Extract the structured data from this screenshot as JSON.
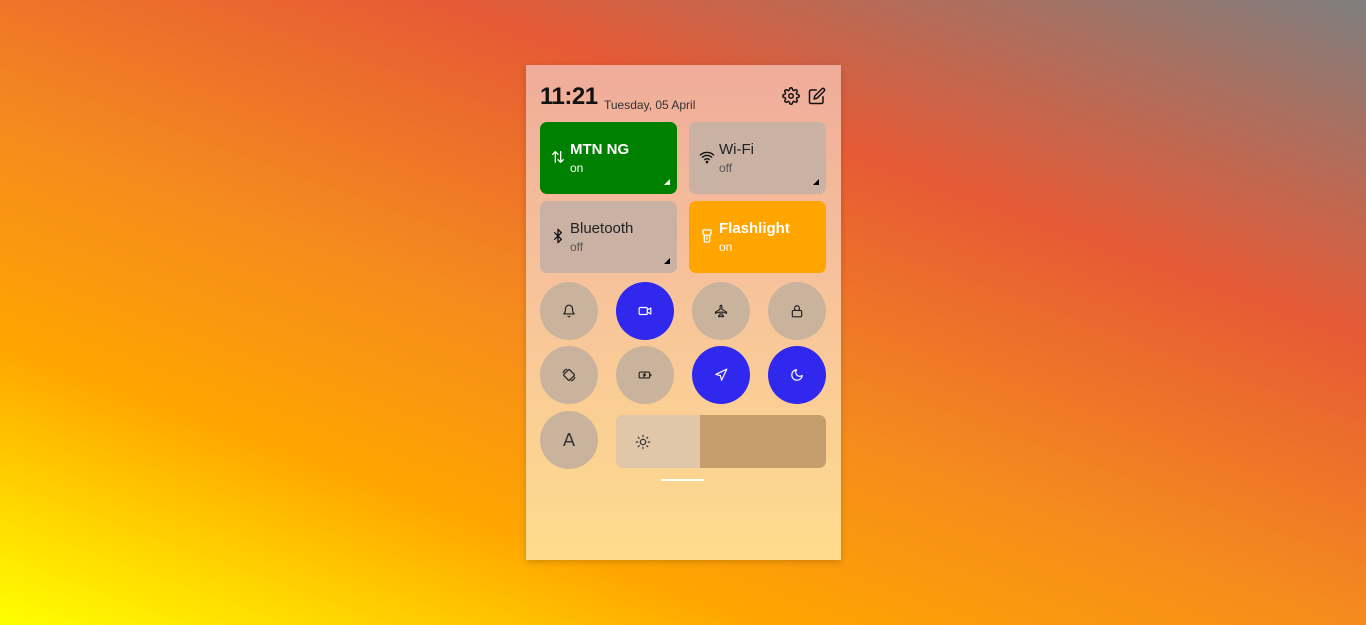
{
  "header": {
    "time": "11:21",
    "date": "Tuesday, 05 April",
    "settings_icon": "gear-icon",
    "edit_icon": "edit-icon"
  },
  "tiles": [
    {
      "name": "MTN NG",
      "state": "on",
      "icon": "mobile-data-icon",
      "color": "#008000"
    },
    {
      "name": "Wi-Fi",
      "state": "off",
      "icon": "wifi-icon",
      "color": "#c9b2a4"
    },
    {
      "name": "Bluetooth",
      "state": "off",
      "icon": "bluetooth-icon",
      "color": "#c9b2a4"
    },
    {
      "name": "Flashlight",
      "state": "on",
      "icon": "flashlight-icon",
      "color": "#ffa500"
    }
  ],
  "toggles": [
    {
      "icon": "bell-icon",
      "active": false
    },
    {
      "icon": "video-camera-icon",
      "active": true
    },
    {
      "icon": "airplane-icon",
      "active": false
    },
    {
      "icon": "lock-icon",
      "active": false
    },
    {
      "icon": "rotate-icon",
      "active": false
    },
    {
      "icon": "battery-saver-icon",
      "active": false
    },
    {
      "icon": "location-icon",
      "active": true
    },
    {
      "icon": "moon-icon",
      "active": true
    }
  ],
  "font_toggle": {
    "label": "A"
  },
  "brightness": {
    "level": 0.4,
    "icon": "sun-icon"
  },
  "colors": {
    "active": "#3128ee",
    "inactive": "#c9b39c"
  }
}
